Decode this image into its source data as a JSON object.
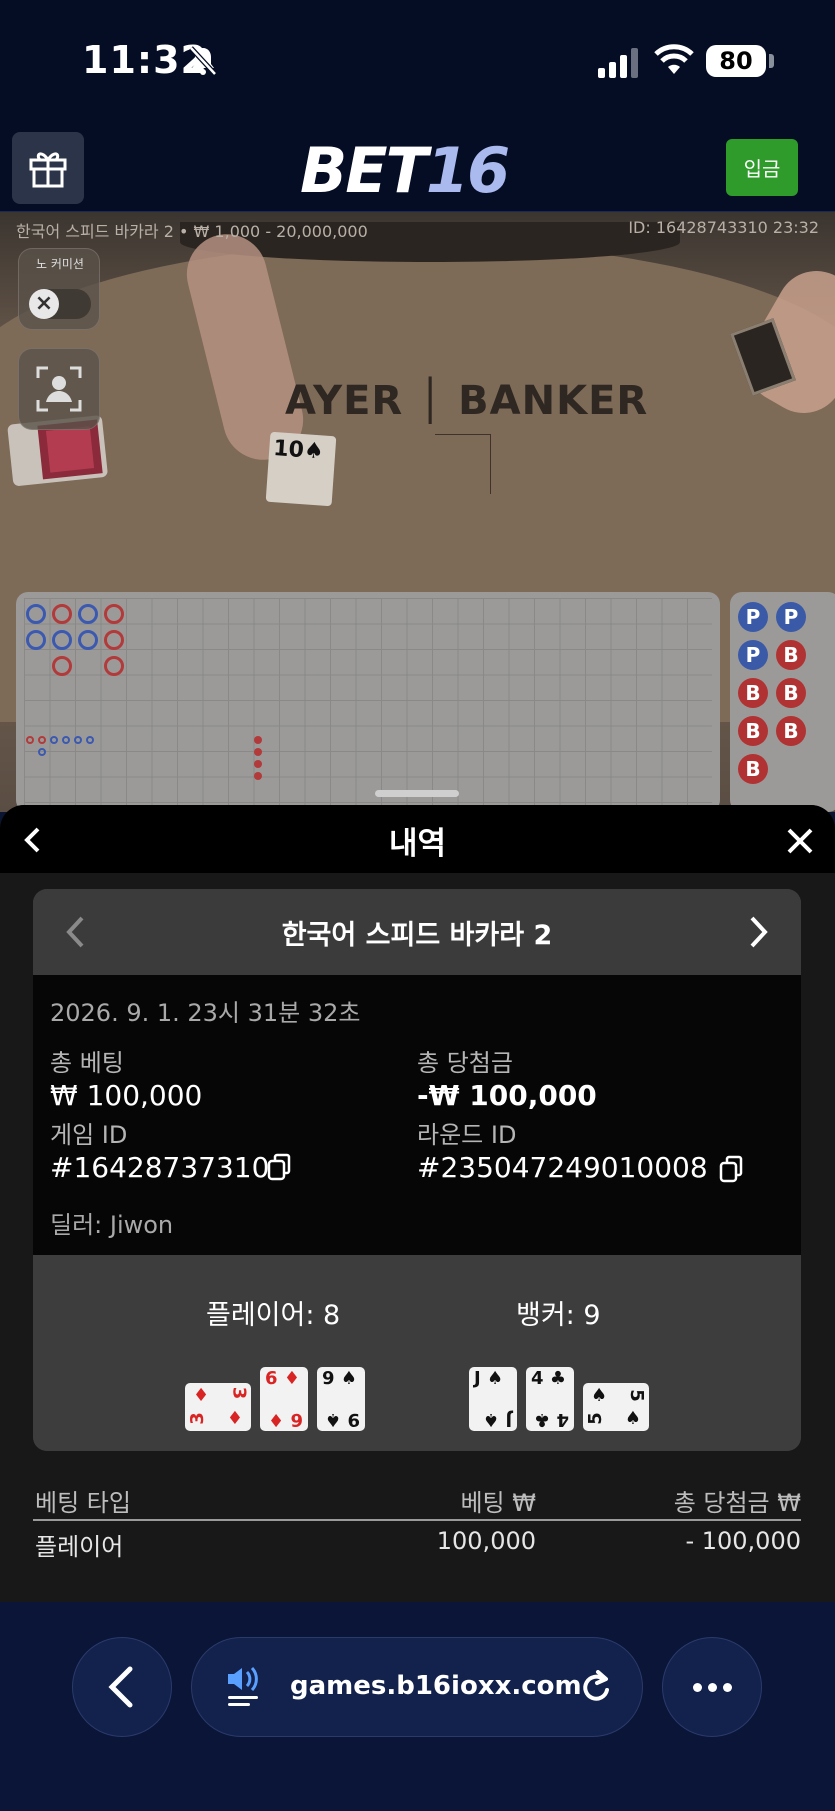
{
  "status_bar": {
    "time": "11:32",
    "battery": "80"
  },
  "header": {
    "logo_main": "BET",
    "logo_num": "16",
    "deposit_label": "입금"
  },
  "game": {
    "table_info": "한국어 스피드 바카라 2 • ₩ 1,000 - 20,000,000",
    "round_info": "ID: 16428743310 23:32",
    "felt_text": "AYER │ BANKER",
    "no_commission_label": "노 커미션",
    "table_card": "10♠"
  },
  "history": {
    "title": "내역",
    "game_name": "한국어 스피드 바카라 2",
    "datetime": "2026. 9. 1. 23시 31분 32초",
    "total_bet_label": "총 베팅",
    "total_bet_value": "₩ 100,000",
    "total_win_label": "총 당첨금",
    "total_win_value": "-₩ 100,000",
    "game_id_label": "게임 ID",
    "game_id_value": "#16428737310",
    "round_id_label": "라운드 ID",
    "round_id_value": "#235047249010008",
    "dealer": "딜러: Jiwon",
    "player_label": "플레이어: 8",
    "banker_label": "뱅커: 9",
    "player_cards": [
      {
        "rank": "3",
        "suit": "♦",
        "color": "red"
      },
      {
        "rank": "6",
        "suit": "♦",
        "color": "red"
      },
      {
        "rank": "9",
        "suit": "♠",
        "color": "black"
      }
    ],
    "banker_cards": [
      {
        "rank": "J",
        "suit": "♠",
        "color": "black"
      },
      {
        "rank": "4",
        "suit": "♣",
        "color": "black"
      },
      {
        "rank": "5",
        "suit": "♠",
        "color": "black"
      }
    ],
    "bets_table": {
      "headers": [
        "베팅 타입",
        "베팅 ₩",
        "총 당첨금 ₩"
      ],
      "rows": [
        [
          "플레이어",
          "100,000",
          "- 100,000"
        ]
      ]
    }
  },
  "browser": {
    "url": "games.b16ioxx.com"
  },
  "colors": {
    "deposit": "#2e9b2b",
    "player": "#3a5aa8",
    "banker": "#b13232"
  }
}
